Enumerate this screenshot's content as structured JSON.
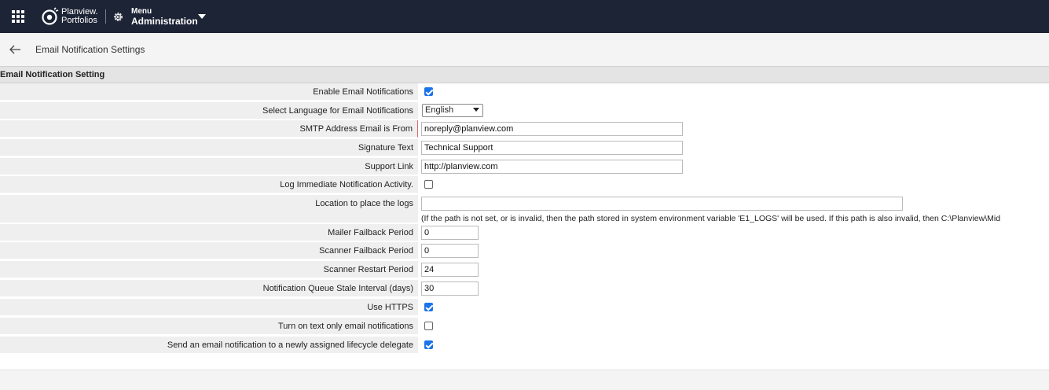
{
  "header": {
    "brand_line1": "Planview.",
    "brand_line2": "Portfolios",
    "menu_small": "Menu",
    "menu_big": "Administration"
  },
  "page": {
    "title": "Email Notification Settings"
  },
  "section": {
    "title": "Email Notification Setting"
  },
  "rows": [
    {
      "label": "Enable Email Notifications",
      "type": "checkbox",
      "checked": true
    },
    {
      "label": "Select Language for Email Notifications",
      "type": "select",
      "value": "English"
    },
    {
      "label": "SMTP Address Email is From",
      "type": "text",
      "value": "noreply@planview.com"
    },
    {
      "label": "Signature Text",
      "type": "text",
      "value": "Technical Support"
    },
    {
      "label": "Support Link",
      "type": "text",
      "value": "http://planview.com"
    },
    {
      "label": "Log Immediate Notification Activity.",
      "type": "checkbox",
      "checked": false
    },
    {
      "label": "Location to place the logs",
      "type": "text",
      "value": "",
      "note": "(If the path is not set, or is invalid, then the path stored in system environment variable 'E1_LOGS' will be used. If this path is also invalid, then C:\\Planview\\Mid"
    },
    {
      "label": "Mailer Failback Period",
      "type": "text",
      "value": "0"
    },
    {
      "label": "Scanner Failback Period",
      "type": "text",
      "value": "0"
    },
    {
      "label": "Scanner Restart Period",
      "type": "text",
      "value": "24"
    },
    {
      "label": "Notification Queue Stale Interval (days)",
      "type": "text",
      "value": "30"
    },
    {
      "label": "Use HTTPS",
      "type": "checkbox",
      "checked": true
    },
    {
      "label": "Turn on text only email notifications",
      "type": "checkbox",
      "checked": false
    },
    {
      "label": "Send an email notification to a newly assigned lifecycle delegate",
      "type": "checkbox",
      "checked": true
    }
  ],
  "colors": {
    "topbar": "#1d2435",
    "checkbox_on": "#1a73e8",
    "label_bg": "#efefef"
  }
}
